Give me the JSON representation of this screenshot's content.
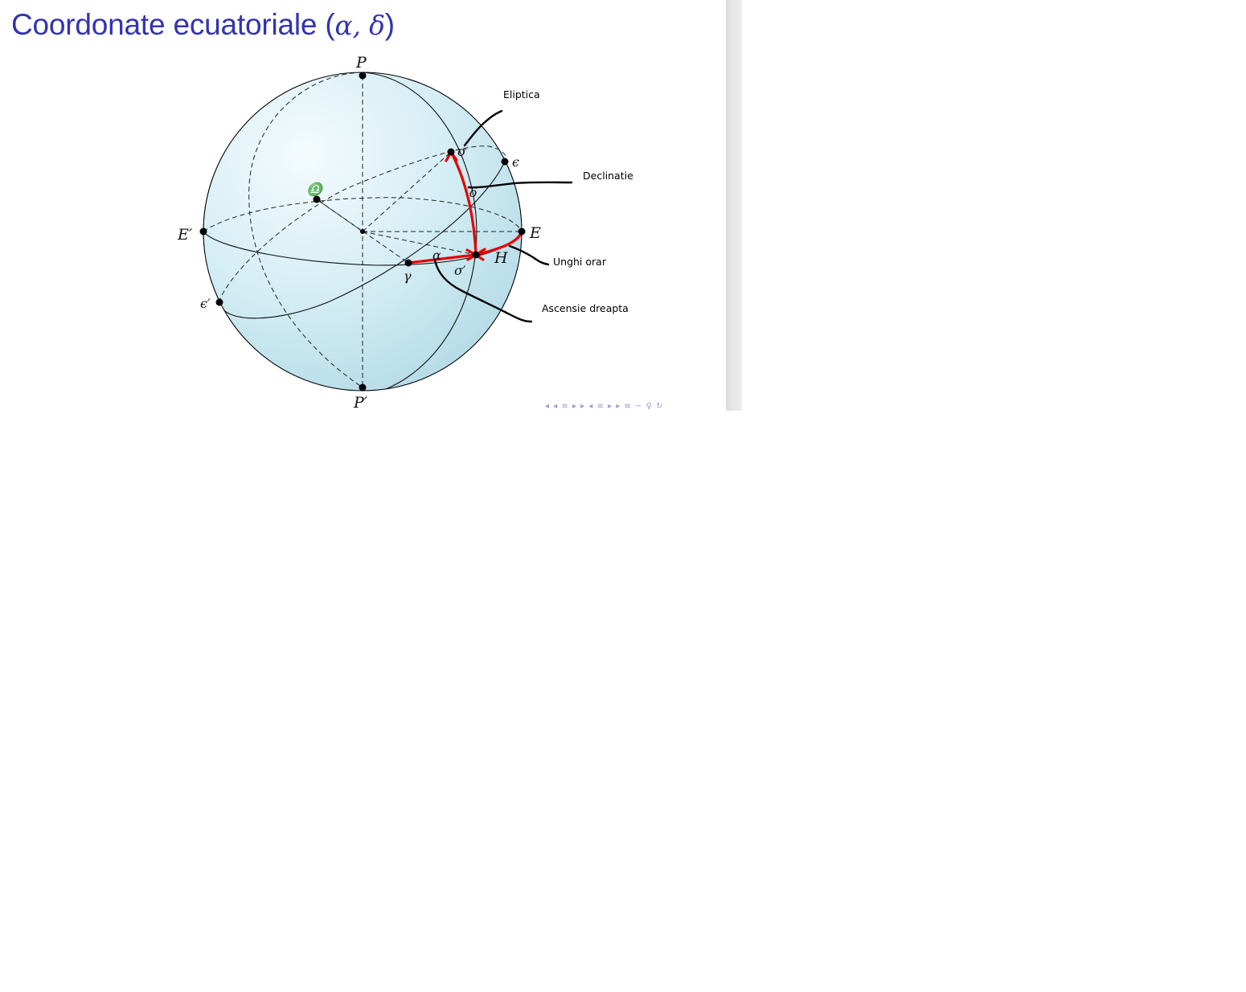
{
  "slide": {
    "title_text": "Coordonate ecuatoriale (",
    "title_math": "α, δ",
    "title_close": ")"
  },
  "diagram": {
    "points": {
      "P": "P",
      "P_prime": "P′",
      "E": "E",
      "E_prime": "E′",
      "epsilon": "ϵ",
      "epsilon_prime": "ϵ′",
      "sigma": "σ",
      "sigma_prime": "σ′",
      "gamma": "γ",
      "libra": "♎",
      "H": "H",
      "alpha": "α",
      "delta": "δ"
    },
    "annotations": {
      "ecliptic": "Eliptica",
      "declination": "Declinatie",
      "hour_angle": "Unghi orar",
      "right_ascension": "Ascensie dreapta"
    },
    "colors": {
      "sphere_light": "#f4fbfd",
      "sphere_dark": "#b8dde9",
      "arc_red": "#e60000",
      "title_blue": "#3333b3"
    }
  },
  "navigation": {
    "symbols": "◂ ◂ ≡ ▸ ▸ ◂ ≡ ▸ ▸   ≡   ∽ ♀ ↻"
  }
}
